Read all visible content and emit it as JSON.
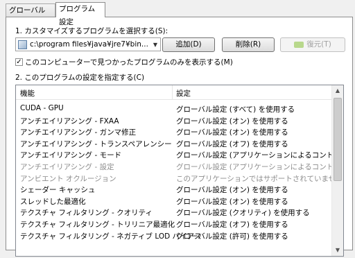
{
  "tabs": [
    {
      "label": "グローバル設定"
    },
    {
      "label": "プログラム設定"
    }
  ],
  "step1": {
    "label": "1. カスタマイズするプログラムを選択する(S):"
  },
  "program_select": {
    "value": "c:\\program files¥java¥jre7¥bin..."
  },
  "buttons": {
    "add": "追加(D)",
    "remove": "削除(R)",
    "restore": "復元(T)"
  },
  "checkbox": {
    "checked": true,
    "label": "このコンピューターで見つかったプログラムのみを表示する(M)"
  },
  "step2": {
    "label": "2. このプログラムの設定を指定する(C)"
  },
  "table": {
    "headers": [
      "機能",
      "設定"
    ],
    "rows": [
      {
        "feature": "CUDA - GPU",
        "setting": "グローバル設定 (すべて) を使用する"
      },
      {
        "feature": "アンチエイリアシング - FXAA",
        "setting": "グローバル設定 (オン) を使用する"
      },
      {
        "feature": "アンチエイリアシング - ガンマ修正",
        "setting": "グローバル設定 (オン) を使用する"
      },
      {
        "feature": "アンチエイリアシング - トランスペアレンシー",
        "setting": "グローバル設定 (オフ) を使用する"
      },
      {
        "feature": "アンチエイリアシング - モード",
        "setting": "グローバル設定 (アプリケーションによるコントロール) ..."
      },
      {
        "feature": "アンチエイリアシング - 設定",
        "setting": "グローバル設定 (アプリケーションによるコントロール) ..."
      },
      {
        "feature": "アンビエント オクルージョン",
        "setting": "このアプリケーションではサポートされていません"
      },
      {
        "feature": "シェーダー キャッシュ",
        "setting": "グローバル設定 (オン) を使用する"
      },
      {
        "feature": "スレッドした最適化",
        "setting": "グローバル設定 (オン) を使用する"
      },
      {
        "feature": "テクスチャ フィルタリング - クオリティ",
        "setting": "グローバル設定 (クオリティ) を使用する"
      },
      {
        "feature": "テクスチャ フィルタリング - トリリニア最適化",
        "setting": "グローバル設定 (オフ) を使用する"
      },
      {
        "feature": "テクスチャ フィルタリング - ネガティブ LOD バイアス",
        "setting": "グローバル設定 (許可) を使用する"
      }
    ]
  }
}
